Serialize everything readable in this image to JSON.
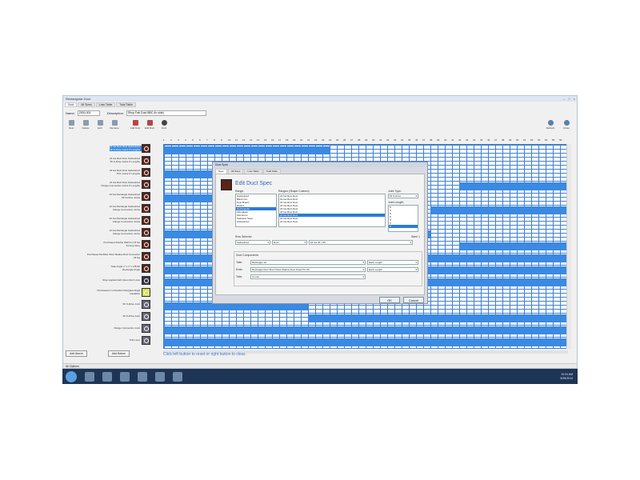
{
  "window": {
    "title": "Rectangular Duct",
    "controls": [
      "–",
      "□",
      "×"
    ],
    "tabs": [
      "Duct",
      "All Sizes",
      "Loss Table",
      "Total Table"
    ]
  },
  "name_row": {
    "name_label": "Name:",
    "name_value": "2000-001",
    "desc_label": "Description:",
    "desc_value": "Shop Fab Duct BBC (in side)"
  },
  "toolbar": {
    "buttons": [
      "New",
      "Delete",
      "Edit",
      "Rename",
      "Add Duct",
      "Edit Duct",
      "Duct"
    ],
    "right": [
      "Refresh",
      "Close"
    ]
  },
  "grid": {
    "column_numbers": [
      "1",
      "2",
      "3",
      "4",
      "5",
      "6",
      "7",
      "8",
      "9",
      "10",
      "11",
      "12",
      "13",
      "14",
      "15",
      "16",
      "17",
      "18",
      "19",
      "20",
      "21",
      "22",
      "23",
      "24",
      "25",
      "26",
      "27",
      "28",
      "29",
      "30",
      "31",
      "32",
      "33",
      "34",
      "35",
      "36",
      "37",
      "38",
      "39",
      "40",
      "41",
      "42",
      "43",
      "44",
      "45",
      "46",
      "47",
      "48",
      "49",
      "50",
      "51",
      "52",
      "53",
      "54",
      "55",
      "56"
    ],
    "rows": [
      {
        "label": "24 Ga Rect Duct Galvanized\n5ft S-Drive Joints 5' Lengths",
        "selected": true
      },
      {
        "label": "24 Ga Rect Duct Galvanized\n5ft S-Drive Joints 5' Lengths",
        "selected": false
      },
      {
        "label": "24 Ga Rect Duct Galvanized\nTDC Joints 5' Lengths",
        "selected": false
      },
      {
        "label": "24 Ga Rect Duct Galvanized\nFlange Connection Joints 5' Lengths",
        "selected": false
      },
      {
        "label": "24 Ga Rectangle Galvanized\n5ft S-Drive Joints",
        "selected": false
      },
      {
        "label": "24 Ga Rectangle Galvanized\nFlange Connection Joints",
        "selected": false
      },
      {
        "label": "24 Ga Rectangle Galvanized\nFlange Connection Joints",
        "selected": false
      },
      {
        "label": "24 Ga Rectangle Galvanized\nFlange Connection Joints",
        "selected": false
      },
      {
        "label": "Purchased Double Wall Fin Oil Ga\nTurning Vane",
        "selected": false
      },
      {
        "label": "Purchased Per/Max Short Radius Duct Connector\nAll Ga",
        "selected": false
      },
      {
        "label": "Take Angle 1\" x 1\" x 1/8x2ft\nRectangle Angle",
        "selected": false
      },
      {
        "label": "Shop Applied Fab Clean Duct Liner",
        "selected": false
      },
      {
        "label": "Purchased 2 in Flexible Fiberglass Rigid\nInsulation",
        "selected": false
      },
      {
        "label": "5ft S-Drive Joint",
        "selected": false
      },
      {
        "label": "5ft S-Drive Joint",
        "selected": false
      },
      {
        "label": "Flange Connection Joint",
        "selected": false
      },
      {
        "label": "TDF Liner",
        "selected": false
      }
    ],
    "buttons": [
      "Add Above",
      "Add Below"
    ],
    "hint": "Click left button to reset or right button to clear."
  },
  "statusbar": "All Options",
  "taskbar": {
    "time": "10:24 AM",
    "date": "5/29/2014"
  },
  "dialog": {
    "title": "Duct Spec",
    "tabs": [
      "Spec",
      "All Sizes",
      "Loss Table",
      "Total Table"
    ],
    "heading": "Edit Duct Spec",
    "range_label": "Range",
    "range_items": [
      "Galvanized",
      "Black Iron",
      "Duct Board",
      "Round",
      "Rectangular",
      "Fiberglass",
      "Aluminum",
      "Stainless Steel",
      "Galvanized"
    ],
    "ranges_label": "Ranges (Shape Custom)",
    "ranges_items": [
      "24 Ga Rect Duct",
      "24 Ga Rect Duct",
      "24 Ga Rect Duct",
      "24 Ga Rect Duct",
      "24 Ga Rect Duct",
      "24 Ga Rect Duct",
      "24 Ga Rect Duct",
      "24 Ga Rect Duct",
      "24 Ga Rect Duct"
    ],
    "joint_type_label": "Joint Type:",
    "joint_type_value": "5ft S-Drive",
    "joint_length_label": "Joint Length:",
    "joint_length_items": [
      "5'",
      "4'",
      "5'",
      "6'",
      "4'",
      "5'",
      "5'"
    ],
    "row_selector_label": "Row Selector",
    "row_selector_values": [
      "Galvanized",
      "Duct",
      "24 Ga 4ft x 5ft"
    ],
    "checkbox_label": "Steel 1",
    "components_label": "Duct Components",
    "component_rows": [
      {
        "label": "Take",
        "value": "Rectangle 1in",
        "extra": "Each Length"
      },
      {
        "label": "Ends",
        "value": "Rectangle Duct Short Piece Radius Duct Fixed PC SF",
        "extra": "Each Length"
      },
      {
        "label": "Tabs",
        "value": "Corner",
        "extra": ""
      }
    ],
    "ok": "OK",
    "cancel": "Cancel"
  }
}
